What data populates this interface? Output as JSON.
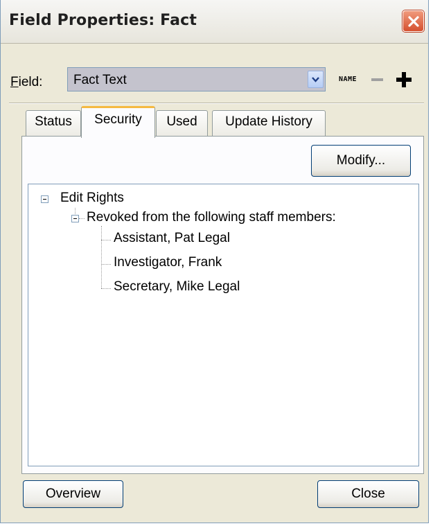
{
  "window": {
    "title": "Field Properties: Fact"
  },
  "field": {
    "label_accesskey": "F",
    "label_rest": "ield:",
    "selected_value": "Fact Text",
    "name_tag": "NAME"
  },
  "tabs": [
    {
      "label": "Status",
      "active": false
    },
    {
      "label": "Security",
      "active": true
    },
    {
      "label": "Used",
      "active": false
    },
    {
      "label": "Update History",
      "active": false
    }
  ],
  "security": {
    "modify_label": "Modify...",
    "tree": {
      "root": "Edit Rights",
      "child": "Revoked from the following staff members:",
      "members": [
        "Assistant, Pat Legal",
        "Investigator, Frank",
        "Secretary, Mike Legal"
      ]
    }
  },
  "buttons": {
    "overview": "Overview",
    "close": "Close"
  },
  "colors": {
    "dialog_bg": "#ece9d8",
    "active_tab_accent": "#f5b941",
    "close_button": "#d5502f"
  }
}
